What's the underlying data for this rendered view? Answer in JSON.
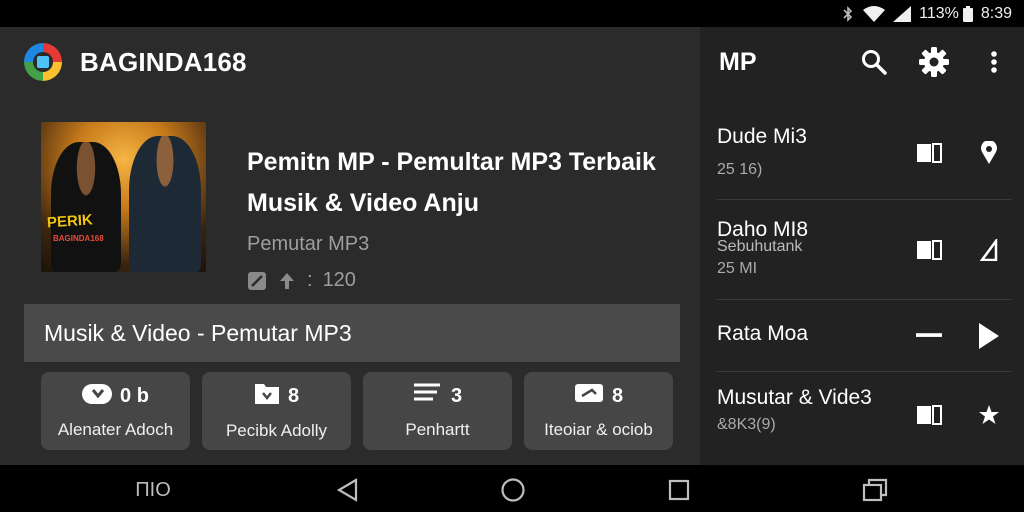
{
  "status_bar": {
    "battery_pct": "113%",
    "time": "8:39"
  },
  "header": {
    "app_title": "BAGINDA168"
  },
  "now_playing": {
    "album_art_text": "PERIK",
    "album_art_sub": "BAGINDA168",
    "title_line1": "Pemitn MP - Pemultar MP3 Terbaik",
    "title_line2": "Musik & Video Anju",
    "artist": "Pemutar MP3",
    "meta_value": "120"
  },
  "section": {
    "label": "Musik & Video - Pemutar MP3"
  },
  "actions": [
    {
      "top": "0 b",
      "label": "Alenater Adoch"
    },
    {
      "top": "8",
      "label": "Pecibk Adolly"
    },
    {
      "top": "3",
      "label": "Penhartt"
    },
    {
      "top": "8",
      "label": "Iteoiar & ociob"
    }
  ],
  "right_pane": {
    "title": "MP",
    "items": [
      {
        "name": "Dude Mi3",
        "sub": "25 16)"
      },
      {
        "name": "Daho MI8",
        "sub": "Sebuhutank",
        "sub2": "25 MI"
      },
      {
        "name": "Rata Moa"
      },
      {
        "name": "Musutar & Vide3",
        "sub": "&8K3(9)"
      }
    ]
  },
  "nav_bar": {
    "left_label": "ΠΙΟ"
  },
  "icons": [
    "bluetooth-icon",
    "wifi-icon",
    "signal-icon",
    "battery-icon",
    "app-logo-icon",
    "search-icon",
    "gear-icon",
    "more-vert-icon",
    "edit-icon",
    "upload-icon",
    "back-icon",
    "home-icon",
    "recents-icon",
    "multiwindow-icon"
  ],
  "colors": {
    "background": "#2b2b2b",
    "right_pane": "#222222",
    "card": "#464646",
    "section_bar": "#4a4a4a",
    "muted_text": "#9e9e9e"
  }
}
